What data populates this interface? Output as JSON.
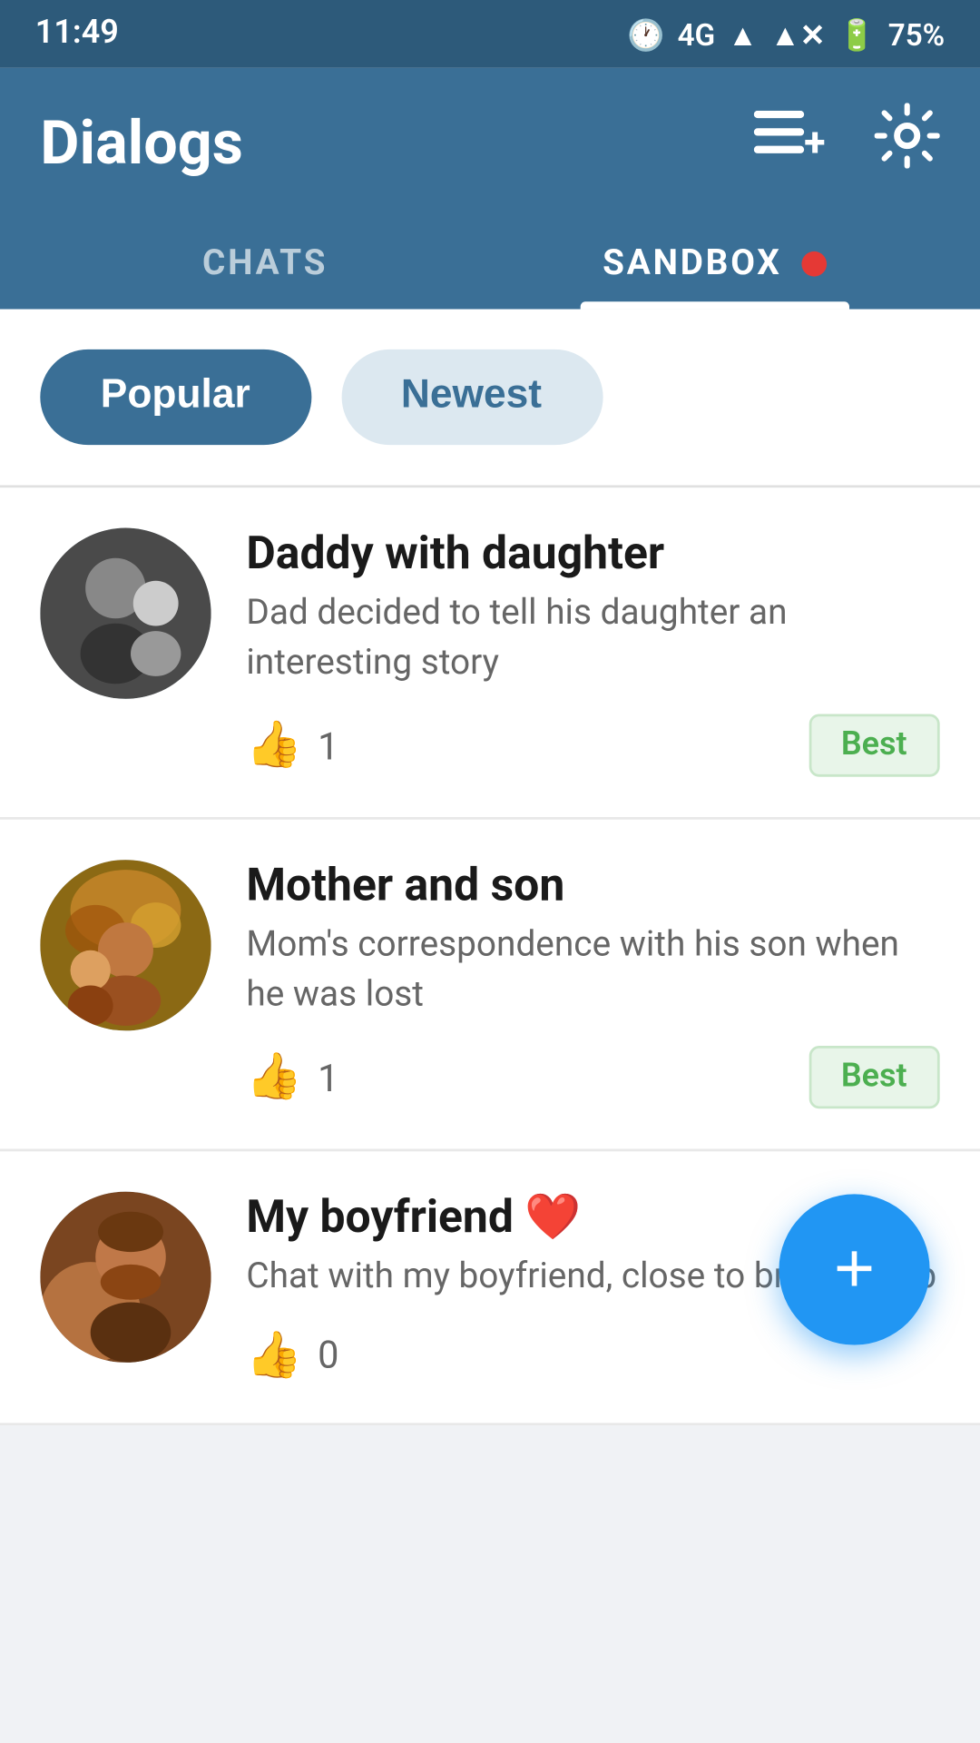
{
  "statusBar": {
    "time": "11:49",
    "signal": "4G",
    "battery": "75%"
  },
  "header": {
    "title": "Dialogs",
    "addIcon": "≡+",
    "settingsIcon": "⚙"
  },
  "tabs": [
    {
      "id": "chats",
      "label": "CHATS",
      "active": false
    },
    {
      "id": "sandbox",
      "label": "SANDBOX",
      "active": true,
      "hasDot": true
    }
  ],
  "filters": [
    {
      "id": "popular",
      "label": "Popular",
      "active": true
    },
    {
      "id": "newest",
      "label": "Newest",
      "active": false
    }
  ],
  "chats": [
    {
      "id": "daddy-daughter",
      "title": "Daddy with daughter",
      "description": "Dad decided to tell his daughter an interesting story",
      "likes": 1,
      "badge": "Best",
      "avatarColor": "#555"
    },
    {
      "id": "mother-son",
      "title": "Mother and son",
      "description": "Mom's correspondence with his son when he was lost",
      "likes": 1,
      "badge": "Best",
      "avatarColor": "#8B6914"
    },
    {
      "id": "my-boyfriend",
      "title": "My boyfriend",
      "titleEmoji": "❤️",
      "description": "Chat with my boyfriend, close to breaking up",
      "likes": 0,
      "badge": null,
      "avatarColor": "#8B4513"
    }
  ],
  "fab": {
    "icon": "+",
    "label": "Add new chat"
  }
}
